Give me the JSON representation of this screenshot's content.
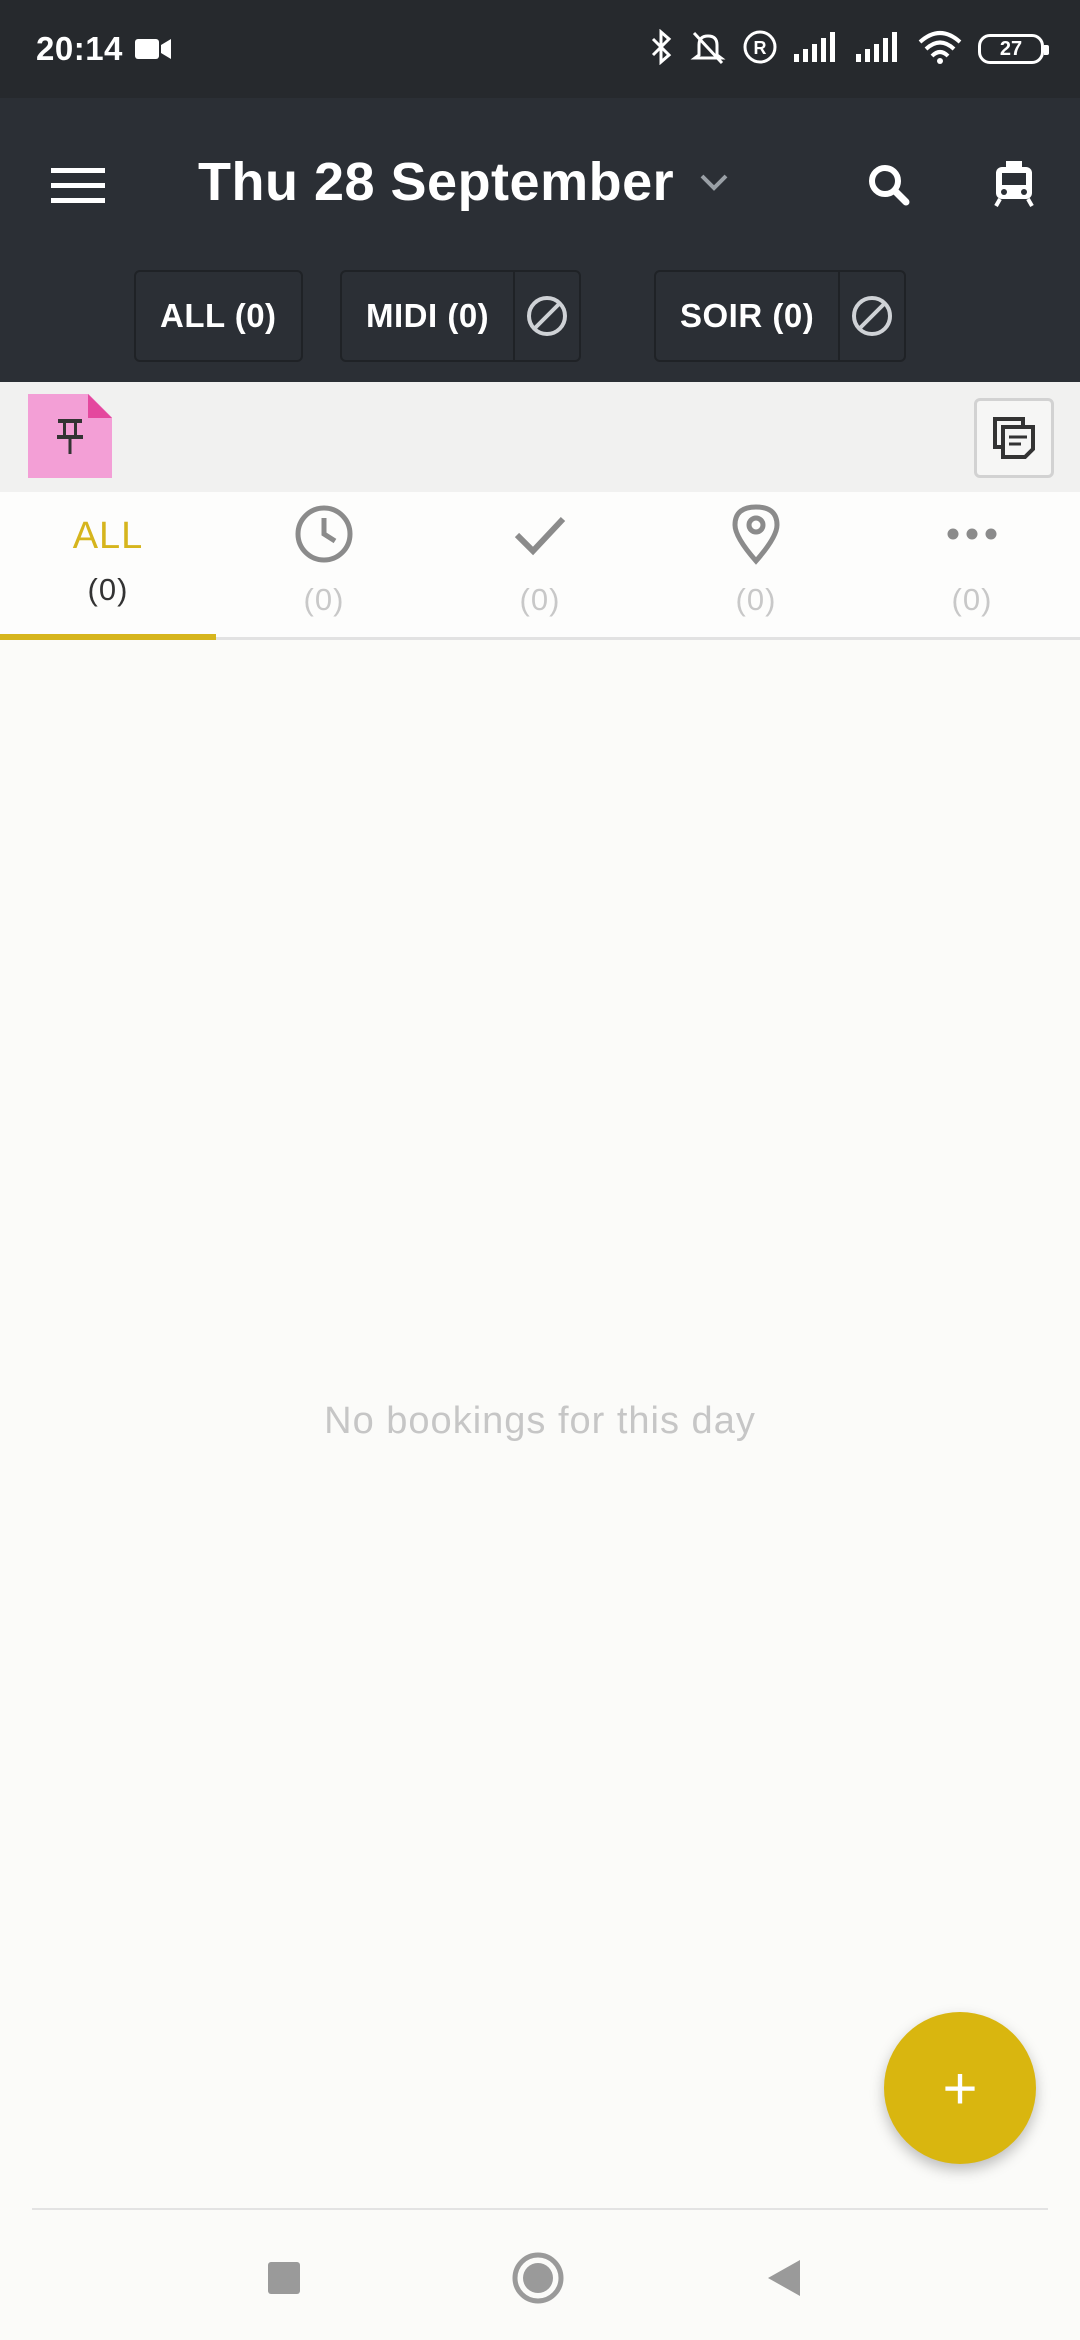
{
  "status_bar": {
    "time": "20:14",
    "battery": "27",
    "icons": [
      "video-camera-icon",
      "bluetooth-icon",
      "notifications-off-icon",
      "registered-icon",
      "signal-icon",
      "signal-icon",
      "wifi-icon",
      "battery-icon"
    ]
  },
  "header": {
    "date_title": "Thu 28 September",
    "menu_icon": "hamburger-menu-icon",
    "dropdown_icon": "chevron-down-icon",
    "search_icon": "search-icon",
    "rail_icon": "train-icon"
  },
  "services": [
    {
      "label": "ALL (0)"
    },
    {
      "label": "MIDI (0)",
      "block_icon": "block-icon"
    },
    {
      "label": "SOIR (0)",
      "block_icon": "block-icon"
    }
  ],
  "toolbar": {
    "pin_icon": "pin-icon",
    "notes_icon": "notes-icon"
  },
  "tabs": [
    {
      "label": "ALL",
      "count": "(0)",
      "active": true
    },
    {
      "icon": "clock-icon",
      "count": "(0)"
    },
    {
      "icon": "check-icon",
      "count": "(0)"
    },
    {
      "icon": "location-pin-icon",
      "count": "(0)"
    },
    {
      "icon": "more-horizontal-icon",
      "count": "(0)"
    }
  ],
  "content": {
    "empty_message": "No bookings for this day"
  },
  "fab": {
    "label": "+"
  },
  "colors": {
    "header_bg": "#2b2f35",
    "accent": "#d6b51d",
    "fab": "#d9b60f",
    "pin_note": "#f39fd6"
  }
}
